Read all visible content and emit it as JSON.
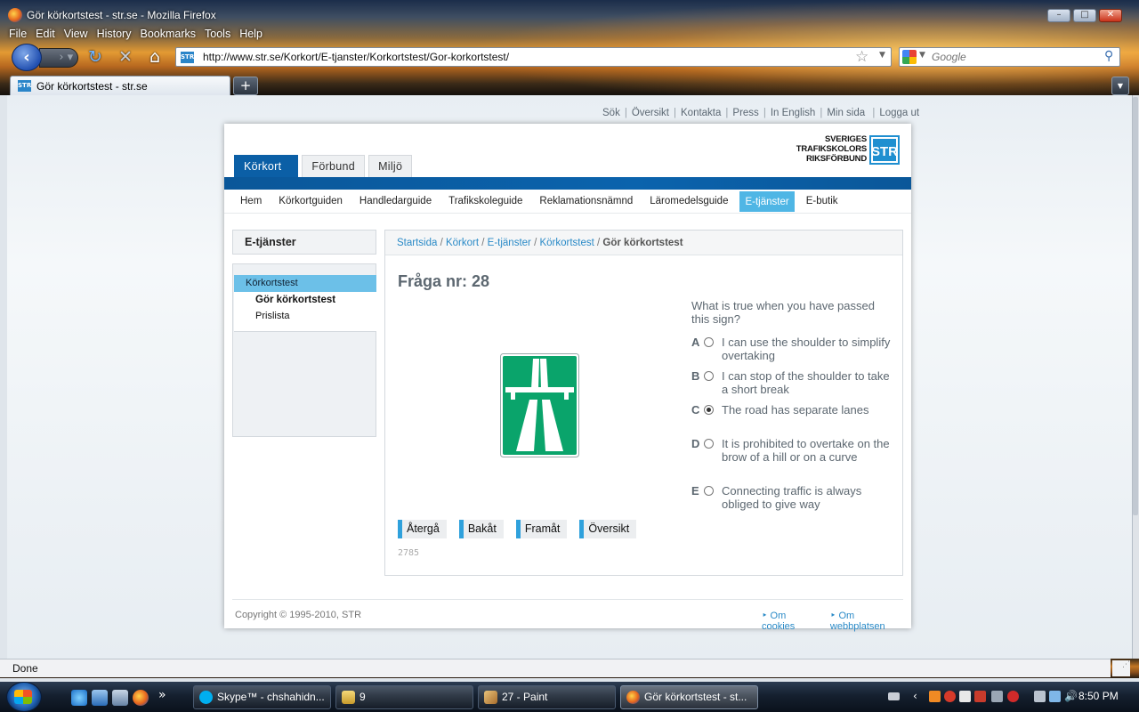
{
  "window": {
    "title": "Gör körkortstest - str.se - Mozilla Firefox",
    "min": "–",
    "max": "□",
    "close": "✕"
  },
  "menu": [
    "File",
    "Edit",
    "View",
    "History",
    "Bookmarks",
    "Tools",
    "Help"
  ],
  "nav": {
    "url": "http://www.str.se/Korkort/E-tjanster/Korkortstest/Gor-korkortstest/",
    "search_placeholder": "Google",
    "favicon_text": "STR"
  },
  "tab": {
    "label": "Gör körkortstest - str.se",
    "new": "+",
    "list": "▼"
  },
  "util_links": [
    "Sök",
    "Översikt",
    "Kontakta",
    "Press",
    "In English",
    "Min sida",
    "Logga ut"
  ],
  "logo": {
    "line1": "SVERIGES",
    "line2": "TRAFIKSKOLORS",
    "line3": "RIKSFÖRBUND",
    "mark": "STR"
  },
  "main_tabs": [
    "Körkort",
    "Förbund",
    "Miljö"
  ],
  "subnav": [
    "Hem",
    "Körkortguiden",
    "Handledarguide",
    "Trafikskoleguide",
    "Reklamationsnämnd",
    "Läromedelsguide",
    "E-tjänster",
    "E-butik"
  ],
  "sidebar": {
    "heading": "E-tjänster",
    "items": [
      "Körkortstest",
      "Gör körkortstest",
      "Prislista"
    ]
  },
  "breadcrumb": {
    "items": [
      "Startsida",
      "Körkort",
      "E-tjänster",
      "Körkortstest"
    ],
    "current": "Gör körkortstest"
  },
  "question": {
    "title": "Fråga nr: 28",
    "text": "What is true when you have passed this sign?",
    "options": [
      {
        "letter": "A",
        "text": "I can use the shoulder to simplify overtaking",
        "checked": false
      },
      {
        "letter": "B",
        "text": "I can stop of the shoulder to take a short break",
        "checked": false
      },
      {
        "letter": "C",
        "text": "The road has separate lanes",
        "checked": true
      },
      {
        "letter": "D",
        "text": "It is prohibited to overtake on the brow of a hill or on a curve",
        "checked": false
      },
      {
        "letter": "E",
        "text": "Connecting traffic is always obliged to give way",
        "checked": false
      }
    ],
    "sign_color": "#0aa46b",
    "id": "2785"
  },
  "buttons": [
    "Återgå",
    "Bakåt",
    "Framåt",
    "Översikt"
  ],
  "footer": {
    "copyright": "Copyright © 1995-2010, STR",
    "links": [
      "Om cookies",
      "Om webbplatsen"
    ]
  },
  "status": "Done",
  "taskbar": {
    "tasks": [
      "Skype™ - chshahidn...",
      "9",
      "27 - Paint",
      "Gör körkortstest - st..."
    ],
    "clock": "8:50 PM"
  },
  "colors": {
    "accent_blue": "#0b5fa6",
    "highlight": "#4fb6e5",
    "link": "#2a8ac7"
  }
}
